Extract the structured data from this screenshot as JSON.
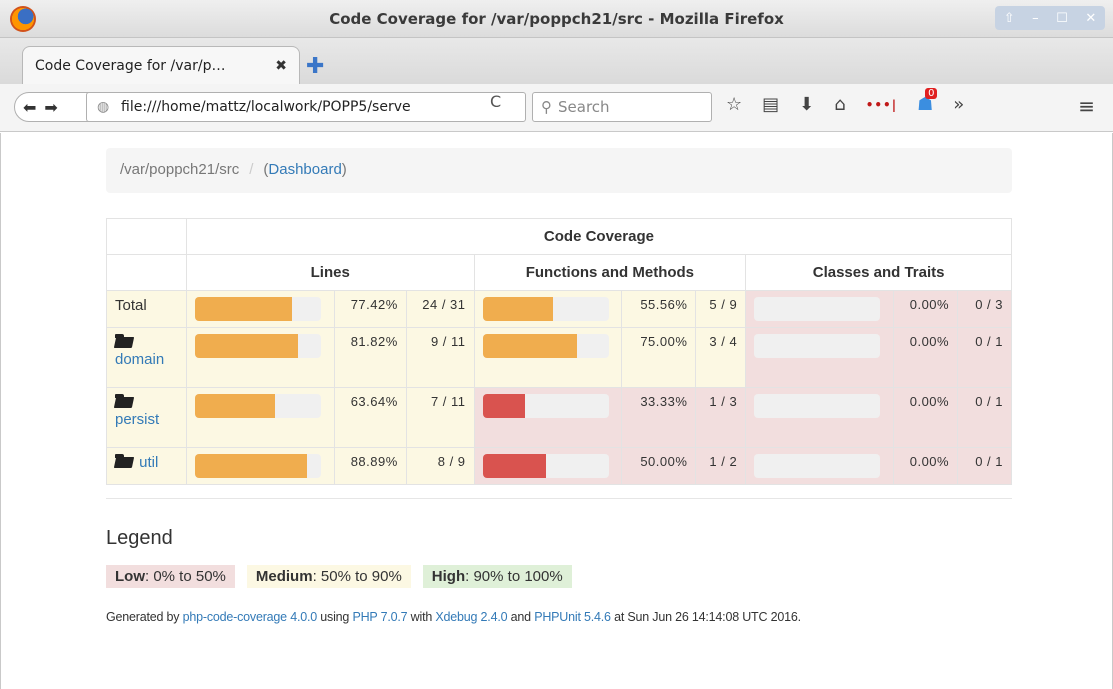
{
  "window": {
    "title": "Code Coverage for /var/poppch21/src - Mozilla Firefox",
    "controls": [
      "⇧",
      "–",
      "☐",
      "✕"
    ]
  },
  "tab": {
    "label": "Code Coverage for /var/p…",
    "close": "✖",
    "new_tab": "✚"
  },
  "nav": {
    "url": "file:///home/mattz/localwork/POPP5/serve",
    "search_placeholder": "Search",
    "reload": "C",
    "badge": "0",
    "overflow": "»",
    "menu": "≡"
  },
  "breadcrumb": {
    "path": "/var/poppch21/src",
    "separator": "/",
    "dashboard_prefix": "(",
    "dashboard": "Dashboard",
    "dashboard_suffix": ")"
  },
  "table": {
    "title": "Code Coverage",
    "groups": [
      "Lines",
      "Functions and Methods",
      "Classes and Traits"
    ],
    "rows": [
      {
        "name": "Total",
        "is_folder": false,
        "lines": {
          "fraction": 0.7742,
          "pct": "77.42%",
          "ratio": "24 / 31",
          "level": "medium"
        },
        "functions": {
          "fraction": 0.5556,
          "pct": "55.56%",
          "ratio": "5 / 9",
          "level": "medium"
        },
        "classes": {
          "fraction": 0,
          "pct": "0.00%",
          "ratio": "0 / 3",
          "level": "low"
        }
      },
      {
        "name": "domain",
        "is_folder": true,
        "lines": {
          "fraction": 0.8182,
          "pct": "81.82%",
          "ratio": "9 / 11",
          "level": "medium"
        },
        "functions": {
          "fraction": 0.75,
          "pct": "75.00%",
          "ratio": "3 / 4",
          "level": "medium"
        },
        "classes": {
          "fraction": 0,
          "pct": "0.00%",
          "ratio": "0 / 1",
          "level": "low"
        }
      },
      {
        "name": "persist",
        "is_folder": true,
        "lines": {
          "fraction": 0.6364,
          "pct": "63.64%",
          "ratio": "7 / 11",
          "level": "medium"
        },
        "functions": {
          "fraction": 0.3333,
          "pct": "33.33%",
          "ratio": "1 / 3",
          "level": "low"
        },
        "classes": {
          "fraction": 0,
          "pct": "0.00%",
          "ratio": "0 / 1",
          "level": "low"
        }
      },
      {
        "name": "util",
        "is_folder": true,
        "lines": {
          "fraction": 0.8889,
          "pct": "88.89%",
          "ratio": "8 / 9",
          "level": "medium"
        },
        "functions": {
          "fraction": 0.5,
          "pct": "50.00%",
          "ratio": "1 / 2",
          "level": "low"
        },
        "classes": {
          "fraction": 0,
          "pct": "0.00%",
          "ratio": "0 / 1",
          "level": "low"
        }
      }
    ]
  },
  "legend": {
    "title": "Legend",
    "low_label": "Low",
    "low_range": ": 0% to 50%",
    "medium_label": "Medium",
    "medium_range": ": 50% to 90%",
    "high_label": "High",
    "high_range": ": 90% to 100%"
  },
  "footer": {
    "t1": "Generated by ",
    "l1": "php-code-coverage 4.0.0",
    "t2": " using ",
    "l2": "PHP 7.0.7",
    "t3": " with ",
    "l3": "Xdebug 2.4.0",
    "t4": " and ",
    "l4": "PHPUnit 5.4.6",
    "t5": " at Sun Jun 26 14:14:08 UTC 2016."
  },
  "colors": {
    "low_bg": "#f2dede",
    "medium_bg": "#fcf8e3",
    "high_bg": "#dff0d8",
    "bar_medium": "#f0ad4e",
    "bar_low": "#d9534f",
    "link": "#337ab7"
  }
}
